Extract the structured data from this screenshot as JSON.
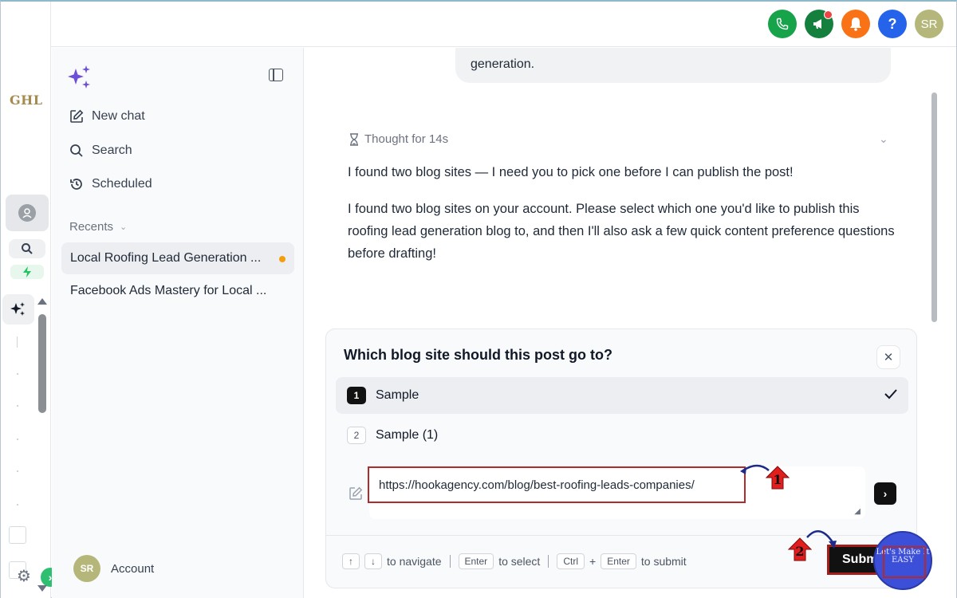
{
  "rail": {
    "logo": "GHL"
  },
  "topbar": {
    "user_initials": "SR",
    "help_label": "?"
  },
  "sidebar": {
    "items": [
      {
        "label": "New chat",
        "icon": "edit-icon"
      },
      {
        "label": "Search",
        "icon": "search-icon"
      },
      {
        "label": "Scheduled",
        "icon": "history-icon"
      }
    ],
    "recents_label": "Recents",
    "recents": [
      {
        "label": "Local Roofing Lead Generation ...",
        "active": true,
        "unread": true
      },
      {
        "label": "Facebook Ads Mastery for Local ...",
        "active": false,
        "unread": false
      }
    ],
    "account": {
      "initials": "SR",
      "label": "Account"
    }
  },
  "chat": {
    "user_bubble_tail": "generation.",
    "thought": "Thought for 14s",
    "message_1": "I found two blog sites — I need you to pick one before I can publish the post!",
    "message_2": "I found two blog sites on your account. Please select which one you'd like to publish this roofing lead generation blog to, and then I'll also ask a few quick content preference questions before drafting!"
  },
  "question": {
    "title": "Which blog site should this post go to?",
    "options": [
      {
        "num": "1",
        "label": "Sample",
        "selected": true
      },
      {
        "num": "2",
        "label": "Sample (1)",
        "selected": false
      }
    ],
    "custom_value": "https://hookagency.com/blog/best-roofing-leads-companies/",
    "hints": {
      "up": "↑",
      "down": "↓",
      "navigate": "to navigate",
      "enter": "Enter",
      "select": "to select",
      "ctrl": "Ctrl",
      "plus": "+",
      "enter2": "Enter",
      "submit": "to submit"
    },
    "submit_label": "Submit"
  },
  "annotations": {
    "step1": "1",
    "step2": "2",
    "watermark": "Let's Make It EASY"
  },
  "colors": {
    "accent": "#111111",
    "highlight_border": "#b22a2a",
    "unread_dot": "#f59e0b",
    "phone": "#16a34a",
    "bell": "#f97316",
    "help": "#2563eb"
  }
}
